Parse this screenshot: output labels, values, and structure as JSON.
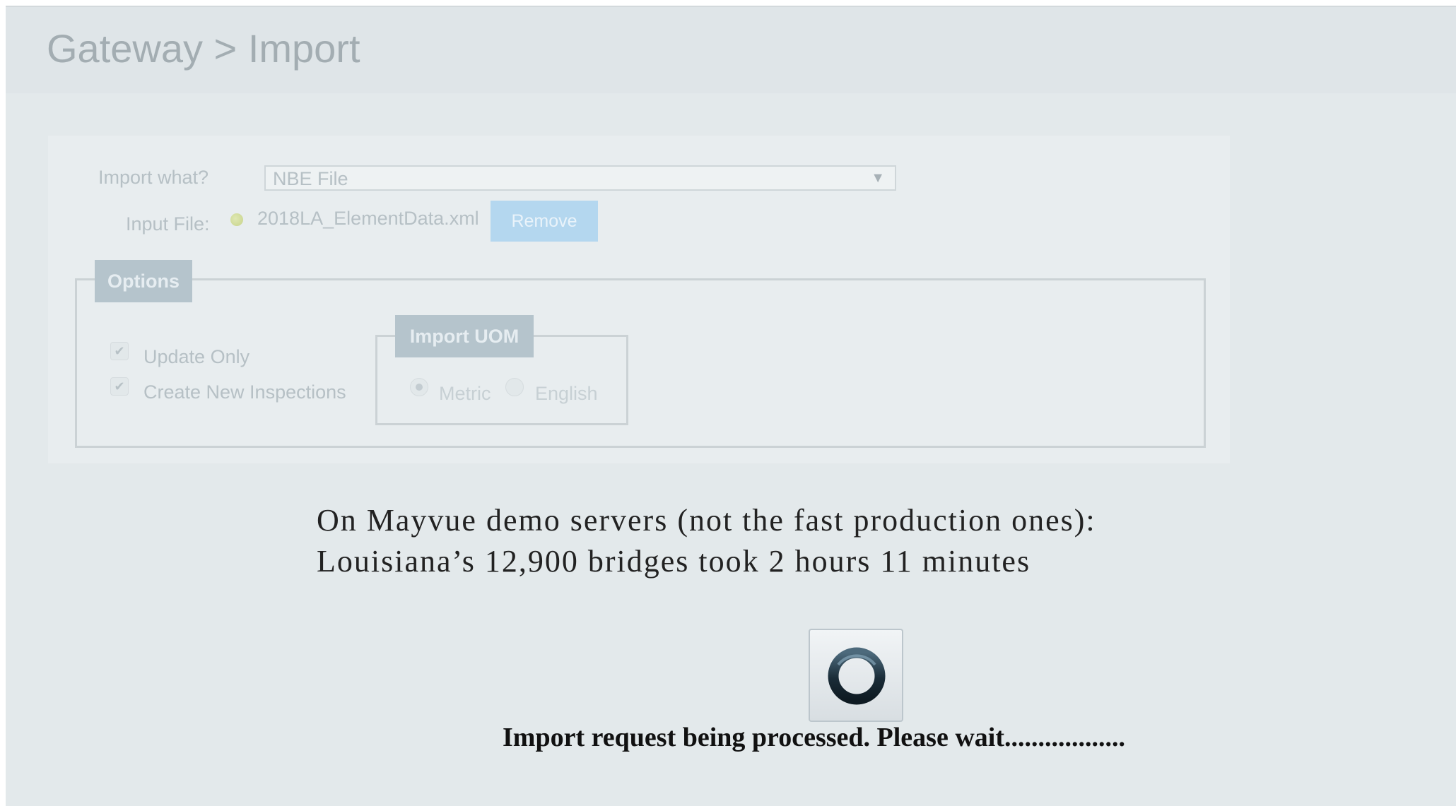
{
  "header": {
    "title": "Gateway > Import"
  },
  "form": {
    "import_what_label": "Import what?",
    "import_what_value": "NBE File",
    "input_file_label": "Input File:",
    "file_name": "2018LA_ElementData.xml",
    "remove_label": "Remove",
    "options": {
      "legend": "Options",
      "update_only": {
        "label": "Update Only",
        "checked": true
      },
      "create_new": {
        "label": "Create New Inspections",
        "checked": true
      }
    },
    "uom": {
      "legend": "Import UOM",
      "options": [
        {
          "label": "Metric",
          "selected": true
        },
        {
          "label": "English",
          "selected": false
        }
      ]
    }
  },
  "note": {
    "line1": "On Mayvue demo servers (not the fast production ones):",
    "line2": "Louisiana’s 12,900 bridges took 2 hours 11 minutes"
  },
  "overlay": {
    "message": "Import request being processed. Please wait..................",
    "spinner_icon": "loading-ring-icon"
  },
  "colors": {
    "remove_button": "#b4d7ef",
    "legend_bg": "#b5c4cc",
    "spinner_ring": "#1c2e3a"
  }
}
